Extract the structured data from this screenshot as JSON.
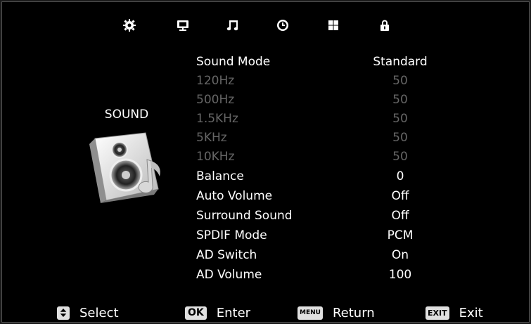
{
  "nav": {
    "tabs": [
      {
        "name": "picture-settings-icon"
      },
      {
        "name": "monitor-icon"
      },
      {
        "name": "music-note-icon"
      },
      {
        "name": "clock-icon"
      },
      {
        "name": "grid-icon"
      },
      {
        "name": "lock-icon"
      }
    ]
  },
  "section": {
    "title": "SOUND"
  },
  "menu": {
    "items": [
      {
        "label": "Sound Mode",
        "value": "Standard",
        "enabled": true
      },
      {
        "label": "120Hz",
        "value": "50",
        "enabled": false
      },
      {
        "label": "500Hz",
        "value": "50",
        "enabled": false
      },
      {
        "label": "1.5KHz",
        "value": "50",
        "enabled": false
      },
      {
        "label": "5KHz",
        "value": "50",
        "enabled": false
      },
      {
        "label": "10KHz",
        "value": "50",
        "enabled": false
      },
      {
        "label": "Balance",
        "value": "0",
        "enabled": true
      },
      {
        "label": "Auto Volume",
        "value": "Off",
        "enabled": true
      },
      {
        "label": "Surround Sound",
        "value": "Off",
        "enabled": true
      },
      {
        "label": "SPDIF Mode",
        "value": "PCM",
        "enabled": true
      },
      {
        "label": "AD Switch",
        "value": "On",
        "enabled": true
      },
      {
        "label": "AD Volume",
        "value": "100",
        "enabled": true
      }
    ]
  },
  "footer": {
    "select": {
      "key_icon": "up-down-arrow-icon",
      "label": "Select"
    },
    "enter": {
      "key": "OK",
      "label": "Enter"
    },
    "return": {
      "key": "MENU",
      "label": "Return"
    },
    "exit": {
      "key": "EXIT",
      "label": "Exit"
    }
  },
  "colors": {
    "background": "#000000",
    "text": "#ffffff",
    "disabled_text": "#666666"
  }
}
